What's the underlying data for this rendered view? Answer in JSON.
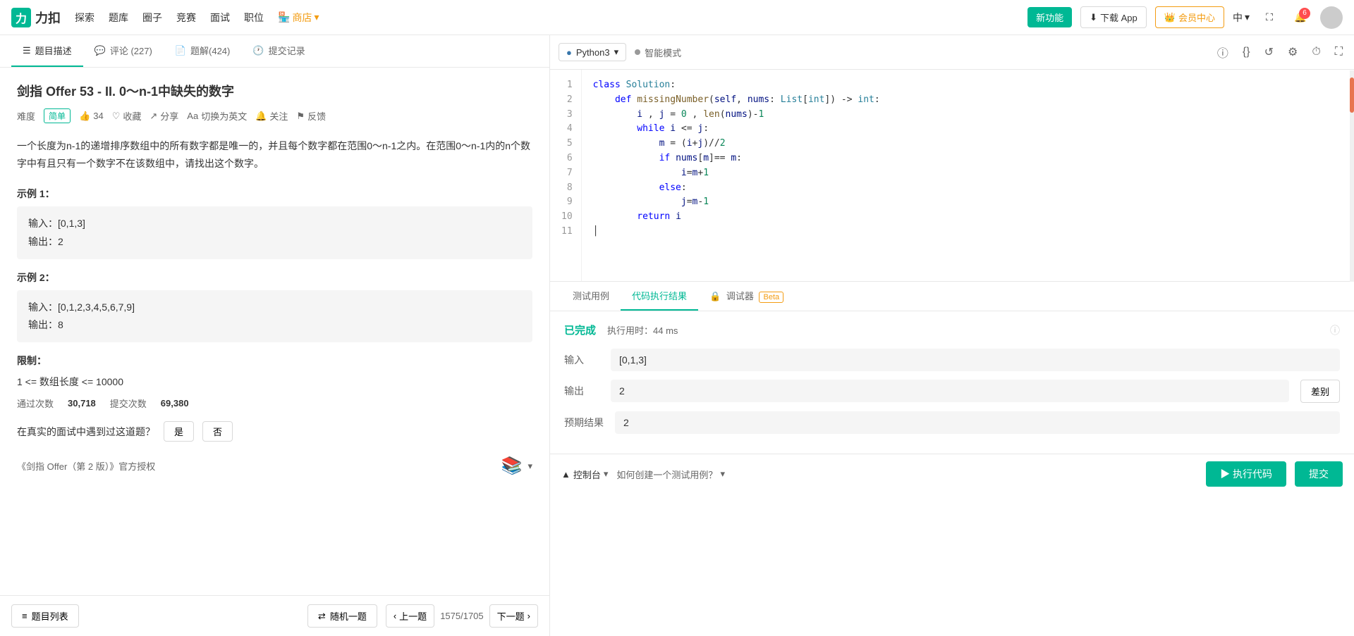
{
  "nav": {
    "logo_text": "力扣",
    "items": [
      "探索",
      "题库",
      "圈子",
      "竞赛",
      "面试",
      "职位"
    ],
    "store": "商店",
    "btn_new": "新功能",
    "btn_download": "下载 App",
    "btn_vip": "会员中心",
    "lang": "中",
    "notifications": "6"
  },
  "tabs": {
    "description": "题目描述",
    "comments": "评论 (227)",
    "solutions": "题解(424)",
    "submissions": "提交记录"
  },
  "problem": {
    "title": "剑指 Offer 53 - II. 0～n-1中缺失的数字",
    "difficulty": "简单",
    "likes": "34",
    "collected": "收藏",
    "share": "分享",
    "switch_lang": "切换为英文",
    "follow": "关注",
    "feedback": "反馈",
    "description": "一个长度为n-1的递增排序数组中的所有数字都是唯一的，并且每个数字都在范围0～n-1之内。在范围0～n-1内的n个数字中有且只有一个数字不在该数组中，请找出这个数字。",
    "example1_title": "示例 1：",
    "example1_input": "输入：[0,1,3]",
    "example1_output": "输出：2",
    "example2_title": "示例 2：",
    "example2_input": "输入：[0,1,2,3,4,5,6,7,9]",
    "example2_output": "输出：8",
    "limit_title": "限制：",
    "limit_text": "1 <= 数组长度 <= 10000",
    "pass_count": "30,718",
    "submit_count": "69,380",
    "pass_label": "通过次数",
    "submit_label": "提交次数",
    "interview_question": "在真实的面试中遇到过这道题？",
    "btn_yes": "是",
    "btn_no": "否",
    "publisher": "《剑指 Offer（第 2 版）》官方授权"
  },
  "bottom_bar": {
    "list": "题目列表",
    "random": "随机一题",
    "prev": "上一题",
    "next": "下一题",
    "page": "1575/1705"
  },
  "editor": {
    "language": "Python3",
    "ai_mode": "智能模式",
    "code_lines": [
      {
        "num": 1,
        "content": "class Solution:"
      },
      {
        "num": 2,
        "content": "    def missingNumber(self, nums: List[int]) -> int:"
      },
      {
        "num": 3,
        "content": "        i , j = 0 , len(nums)-1"
      },
      {
        "num": 4,
        "content": "        while i <= j:"
      },
      {
        "num": 5,
        "content": "            m = (i+j)//2"
      },
      {
        "num": 6,
        "content": "            if nums[m]== m:"
      },
      {
        "num": 7,
        "content": "                i=m+1"
      },
      {
        "num": 8,
        "content": "            else:"
      },
      {
        "num": 9,
        "content": "                j=m-1"
      },
      {
        "num": 10,
        "content": "        return i"
      },
      {
        "num": 11,
        "content": ""
      }
    ]
  },
  "result_tabs": {
    "test_case": "测试用例",
    "exec_result": "代码执行结果",
    "debugger": "调试器",
    "beta": "Beta"
  },
  "result": {
    "status": "已完成",
    "time": "执行用时：44 ms",
    "input_label": "输入",
    "input_value": "[0,1,3]",
    "output_label": "输出",
    "output_value": "2",
    "expected_label": "预期结果",
    "expected_value": "2",
    "diff_btn": "差别"
  },
  "action_bar": {
    "console": "控制台",
    "how_to": "如何创建一个测试用例？",
    "run": "▶ 执行代码",
    "submit": "提交"
  }
}
